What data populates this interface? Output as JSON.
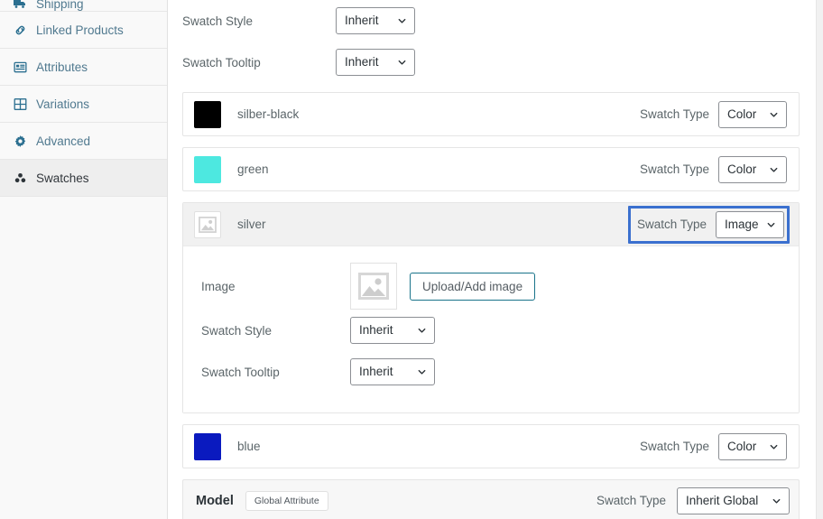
{
  "sidebar": {
    "items": [
      {
        "label": "Shipping",
        "icon": "truck-icon",
        "partial": true,
        "active": false
      },
      {
        "label": "Linked Products",
        "icon": "link-icon",
        "partial": false,
        "active": false
      },
      {
        "label": "Attributes",
        "icon": "attributes-icon",
        "partial": false,
        "active": false
      },
      {
        "label": "Variations",
        "icon": "grid-icon",
        "partial": false,
        "active": false
      },
      {
        "label": "Advanced",
        "icon": "gear-icon",
        "partial": false,
        "active": false
      },
      {
        "label": "Swatches",
        "icon": "swatches-icon",
        "partial": false,
        "active": true
      }
    ]
  },
  "top_fields": [
    {
      "label": "Swatch Style",
      "value": "Inherit"
    },
    {
      "label": "Swatch Tooltip",
      "value": "Inherit"
    }
  ],
  "swatches": [
    {
      "name": "silber-black",
      "chip_color": "#000000",
      "chip_kind": "color",
      "type_label": "Swatch Type",
      "type_value": "Color",
      "focused": false,
      "expanded": false
    },
    {
      "name": "green",
      "chip_color": "#4DE8E0",
      "chip_kind": "color",
      "type_label": "Swatch Type",
      "type_value": "Color",
      "focused": false,
      "expanded": false
    },
    {
      "name": "silver",
      "chip_color": "#f0f0f0",
      "chip_kind": "image-placeholder",
      "type_label": "Swatch Type",
      "type_value": "Image",
      "focused": true,
      "expanded": true,
      "panel": {
        "image_label": "Image",
        "upload_button": "Upload/Add image",
        "fields": [
          {
            "label": "Swatch Style",
            "value": "Inherit"
          },
          {
            "label": "Swatch Tooltip",
            "value": "Inherit"
          }
        ]
      }
    },
    {
      "name": "blue",
      "chip_color": "#0A1ABF",
      "chip_kind": "color",
      "type_label": "Swatch Type",
      "type_value": "Color",
      "focused": false,
      "expanded": false
    }
  ],
  "model_bar": {
    "title": "Model",
    "tag": "Global Attribute",
    "type_label": "Swatch Type",
    "type_value": "Inherit Global"
  },
  "colors": {
    "focus_outline": "#3b70cf",
    "sidebar_link": "#2b6f90",
    "upload_border": "#19738a",
    "active_row_bg": "#f1f1f1"
  }
}
